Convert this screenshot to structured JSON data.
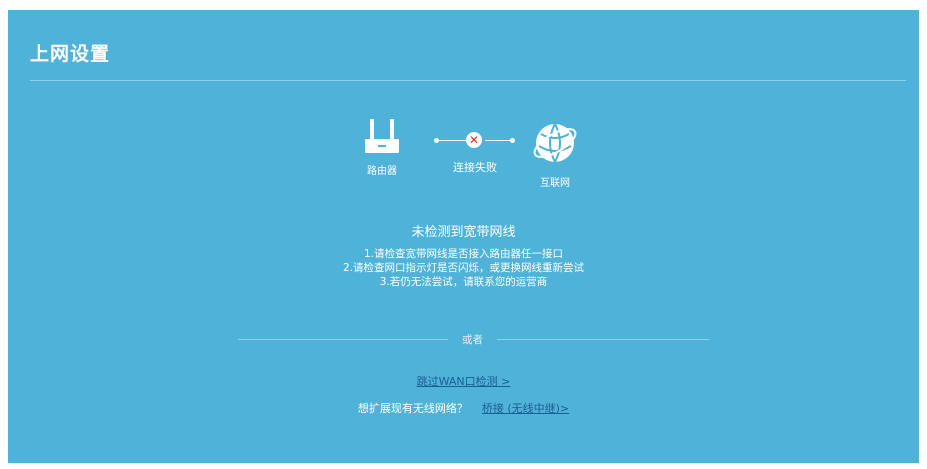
{
  "header": {
    "title": "上网设置"
  },
  "diagram": {
    "router_label": "路由器",
    "status_label": "连接失败",
    "internet_label": "互联网",
    "router_icon": "router-icon",
    "status_icon": "fail-x-icon",
    "internet_icon": "globe-icon",
    "status_color": "#e0342d"
  },
  "status": {
    "heading": "未检测到宽带网线",
    "tips": [
      "1.请检查宽带网线是否接入路由器任一接口",
      "2.请检查网口指示灯是否闪烁，或更换网线重新尝试",
      "3.若仍无法尝试，请联系您的运营商"
    ]
  },
  "alternatives": {
    "or_label": "或者",
    "skip_link": "跳过WAN口检测 >",
    "bridge_prompt": "想扩展现有无线网络？",
    "bridge_link": "桥接 (无线中继)>"
  },
  "colors": {
    "panel_background": "#4fb3d9",
    "link": "#1b5e94"
  }
}
